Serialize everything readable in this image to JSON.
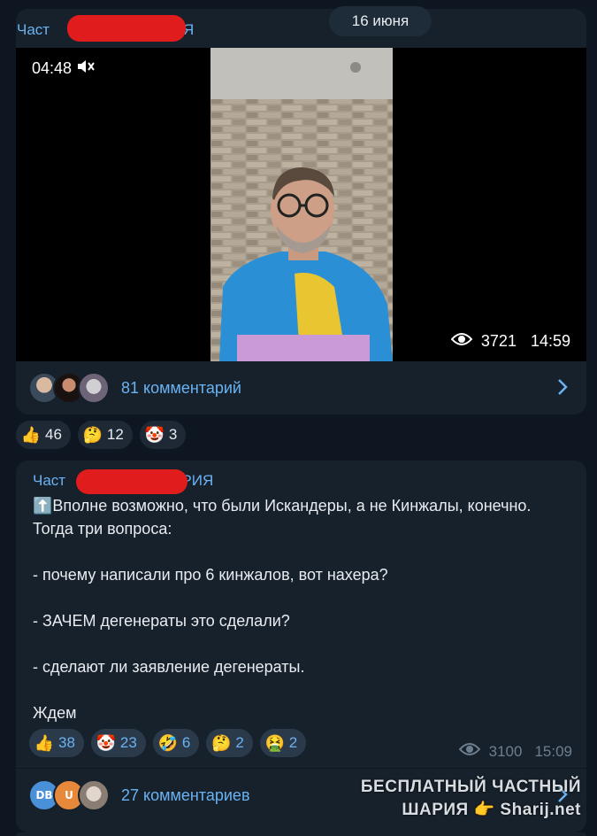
{
  "date_separator": "16 июня",
  "post1": {
    "author_start": "Част",
    "author_end": "АРИЯ",
    "video": {
      "elapsed": "04:48",
      "views": "3721",
      "time": "14:59"
    },
    "comments_label": "81 комментарий",
    "reactions": [
      {
        "icon": "thumbs-up",
        "glyph": "👍",
        "count": "46"
      },
      {
        "icon": "thinking",
        "glyph": "🤔",
        "count": "12"
      },
      {
        "icon": "clown",
        "glyph": "🤡",
        "count": "3"
      }
    ]
  },
  "post2": {
    "author_start": "Част",
    "author_end": "АРИЯ",
    "text": "⬆️Вполне возможно, что были Искандеры, а не Кинжалы, конечно. Тогда три вопроса:\n\n- почему написали про 6 кинжалов, вот нахера?\n\n- ЗАЧЕМ дегенераты это сделали?\n\n- сделают ли заявление дегенераты.\n\nЖдем",
    "reactions": [
      {
        "icon": "thumbs-up",
        "glyph": "👍",
        "count": "38"
      },
      {
        "icon": "clown",
        "glyph": "🤡",
        "count": "23"
      },
      {
        "icon": "rofl",
        "glyph": "🤣",
        "count": "6"
      },
      {
        "icon": "thinking",
        "glyph": "🤔",
        "count": "2"
      },
      {
        "icon": "nauseated",
        "glyph": "🤮",
        "count": "2"
      }
    ],
    "views": "3100",
    "time": "15:09",
    "comments_label": "27 комментариев",
    "avatar_initials": [
      "DB",
      "U"
    ]
  },
  "watermark": {
    "line1": "БЕСПЛАТНЫЙ ЧАСТНЫЙ",
    "line2_a": "ШАРИЯ",
    "line2_b": "Sharij.net"
  },
  "colors": {
    "bg": "#0e1621",
    "bubble": "#17212b",
    "accent": "#6ab2f2",
    "redaction": "#e01c1c"
  }
}
